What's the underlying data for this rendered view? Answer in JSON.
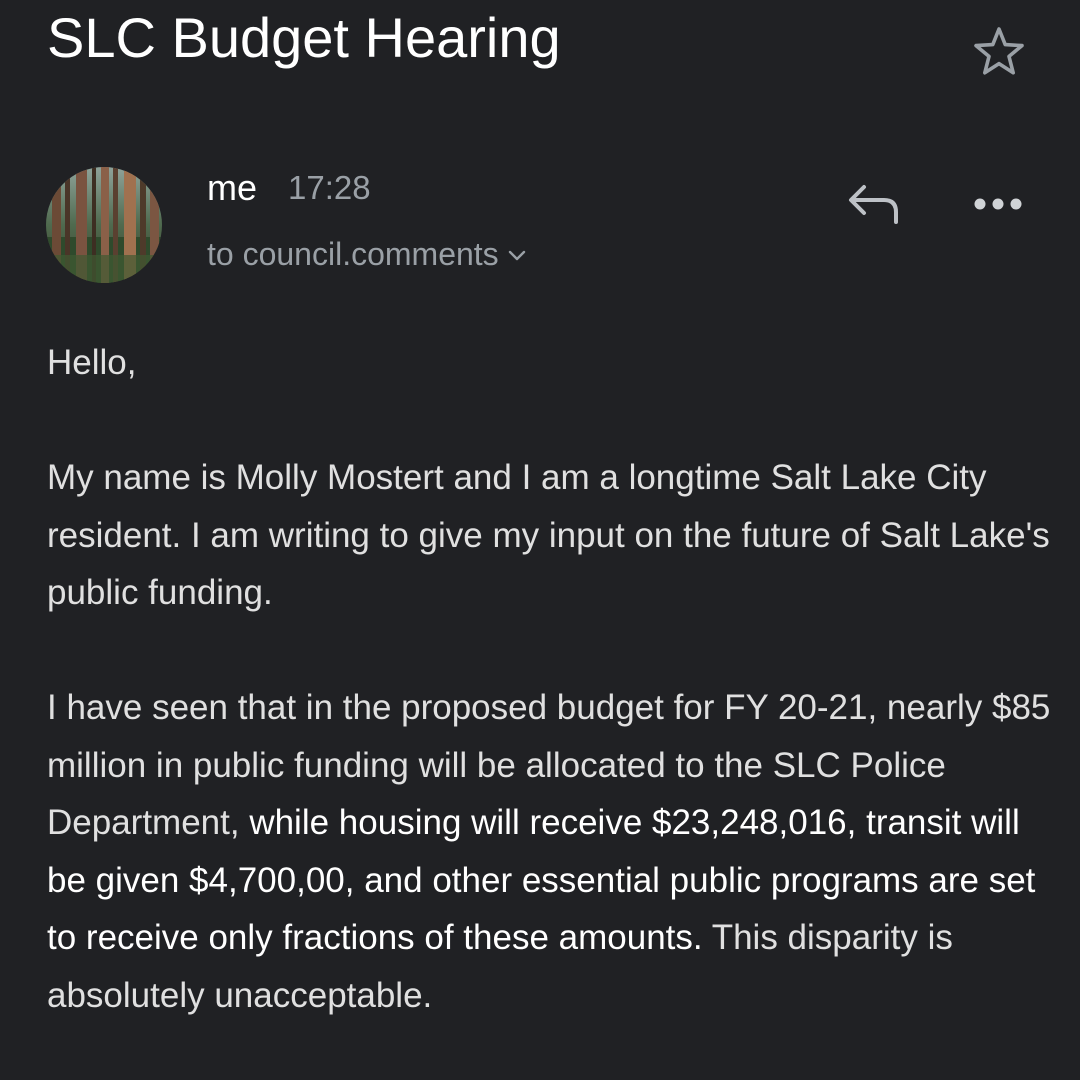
{
  "email": {
    "subject": "SLC Budget Hearing",
    "sender": "me",
    "time": "17:28",
    "recipient": "to council.comments",
    "actions": {
      "star_icon": "star-outline-icon",
      "reply_icon": "reply-arrow-icon",
      "more_icon": "more-horizontal-icon",
      "expand_icon": "chevron-down-icon"
    },
    "avatar_icon": "forest-avatar"
  },
  "body": {
    "greeting": "Hello,",
    "paragraph1": "My name is Molly Mostert and I am a longtime Salt Lake City resident. I am writing to give my input on the future of Salt Lake's public funding.",
    "paragraph2_part1": "I have seen that in the proposed budget for FY 20-21, nearly $85 million in public funding will be allocated to the SLC Police Department,",
    "paragraph2_part2": " while housing will receive $23,248,016, transit will be given $4,700,00, and other essential public programs are set to receive only fractions of these amounts.",
    "paragraph2_part3": " This disparity is absolutely unacceptable."
  },
  "colors": {
    "background": "#202124",
    "primary_text": "#ffffff",
    "secondary_text": "#9aa0a6"
  }
}
